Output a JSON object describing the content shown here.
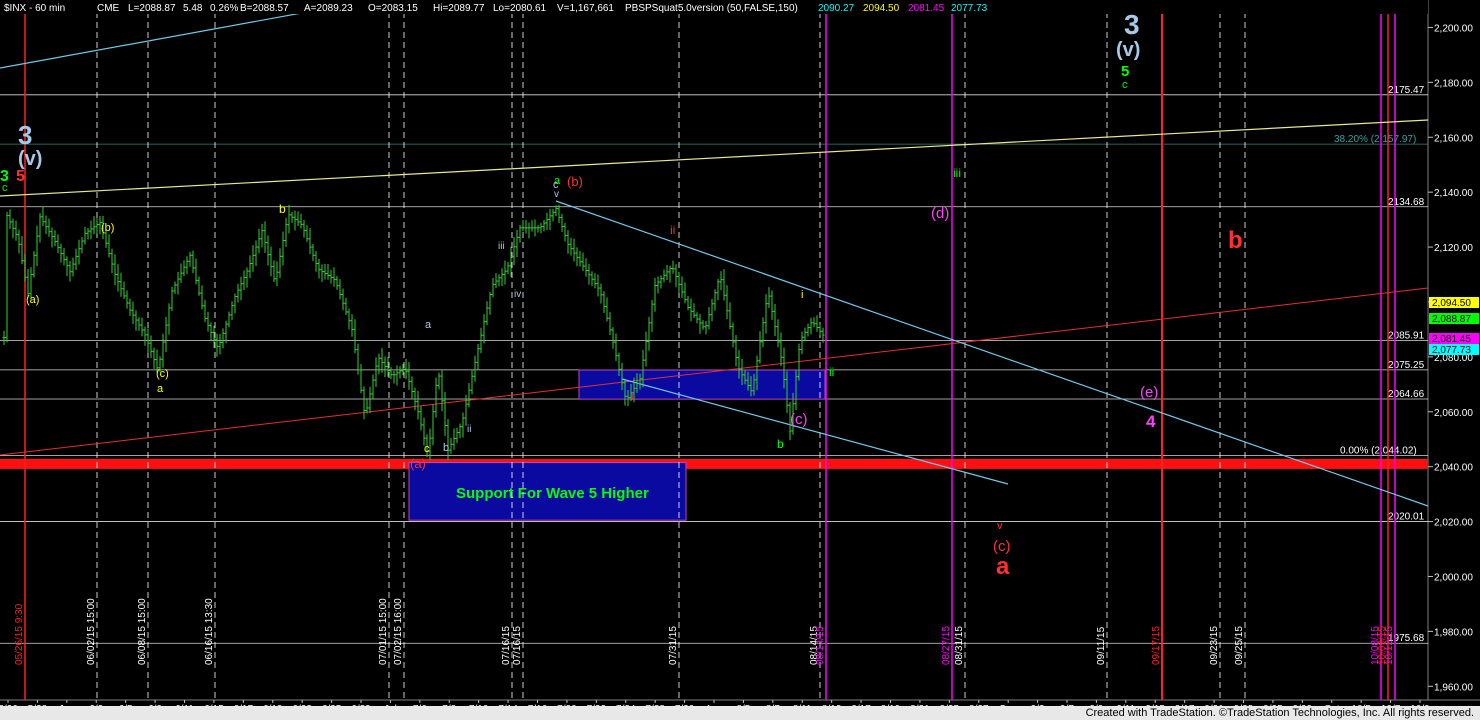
{
  "chart_data": {
    "type": "candlestick",
    "header": {
      "symbol": "$INX - 60 min",
      "exchange": "CME",
      "last": "L=2088.87",
      "change": "5.48",
      "change_pct": "0.26%",
      "bid": "B=2088.57",
      "ask": "A=2089.23",
      "open": "O=2083.15",
      "high": "Hi=2089.77",
      "low": "Lo=2080.61",
      "volume": "V=1,167,661",
      "indicator": "PBSPSquat5.0version (50,FALSE,150)",
      "ind_values": [
        "2090.27",
        "2094.50",
        "2081.45",
        "2077.73"
      ],
      "ind_colors": [
        "#00ffff",
        "#ffff00",
        "#ff00ff",
        "#00ffff"
      ]
    },
    "ylim": [
      1955,
      2210
    ],
    "y_ticks": [
      "1,960.00",
      "1,980.00",
      "2,000.00",
      "2,020.00",
      "2,040.00",
      "2,060.00",
      "2,080.00",
      "2,100.00",
      "2,120.00",
      "2,140.00",
      "2,160.00",
      "2,180.00",
      "2,200.00"
    ],
    "y_tick_values": [
      1960,
      1980,
      2000,
      2020,
      2040,
      2060,
      2080,
      2100,
      2120,
      2140,
      2160,
      2180,
      2200
    ],
    "x_ticks": [
      "5/26",
      "5/28",
      "Jun",
      "6/3",
      "6/5",
      "6/9",
      "6/11",
      "6/15",
      "6/17",
      "6/19",
      "6/23",
      "6/25",
      "6/29",
      "Jul",
      "7/6",
      "7/8",
      "7/10",
      "7/14",
      "7/16",
      "7/20",
      "7/22",
      "7/24",
      "7/28",
      "7/30",
      "Aug",
      "8/5",
      "8/7",
      "8/11",
      "8/13",
      "8/17",
      "8/19",
      "8/21",
      "8/25",
      "8/27",
      "Sep",
      "9/3",
      "9/7",
      "9/9",
      "9/11",
      "9/15",
      "9/17",
      "9/21",
      "9/23",
      "9/25",
      "9/29",
      "Oct",
      "10/5",
      "10/7",
      "10/9"
    ],
    "price_lines": [
      {
        "value": 2175.47,
        "label": "2175.47",
        "color": "#ffffff"
      },
      {
        "value": 2134.68,
        "label": "2134.68",
        "color": "#ffffff"
      },
      {
        "value": 2085.91,
        "label": "2085.91",
        "color": "#ffffff"
      },
      {
        "value": 2075.25,
        "label": "2075.25",
        "color": "#ffffff"
      },
      {
        "value": 2064.66,
        "label": "2064.66",
        "color": "#ffffff"
      },
      {
        "value": 2044.02,
        "label": "0.00% (2,044.02)",
        "color": "#ffffff"
      },
      {
        "value": 2020.01,
        "label": "2020.01",
        "color": "#ffffff"
      },
      {
        "value": 1975.68,
        "label": "1975.68",
        "color": "#ffffff"
      },
      {
        "value": 2157.5,
        "label": "38.20% (2,157.97)",
        "color": "#3aa0a0"
      }
    ],
    "last_price_tags": [
      {
        "value": 2094.5,
        "label": "2,094.50",
        "bg": "#ffff00",
        "fg": "#000000"
      },
      {
        "value": 2088.87,
        "label": "2,088.87",
        "bg": "#00ff00",
        "fg": "#000000"
      },
      {
        "value": 2081.45,
        "label": "2,081.45",
        "bg": "#ff00ff",
        "fg": "#000000"
      },
      {
        "value": 2077.73,
        "label": "2,077.73",
        "bg": "#00ffff",
        "fg": "#000000"
      }
    ],
    "support_band": {
      "value": 2041,
      "label": "Support For Wave 5 Higher"
    },
    "date_markers": [
      {
        "label": "05/26/15 9:30"
      },
      {
        "label": "06/02/15 15:00"
      },
      {
        "label": "06/08/15 15:00"
      },
      {
        "label": "06/16/15 13:30"
      },
      {
        "label": "07/01/15 15:00"
      },
      {
        "label": "07/02/15 16:00"
      },
      {
        "label": "07/16/15"
      },
      {
        "label": "07/16/15"
      },
      {
        "label": "07/31/15"
      },
      {
        "label": "08/14/15"
      },
      {
        "label": "08/14/15"
      },
      {
        "label": "08/27/15"
      },
      {
        "label": "08/31/15"
      },
      {
        "label": "09/11/15"
      },
      {
        "label": "09/17/15"
      },
      {
        "label": "09/23/15"
      },
      {
        "label": "09/25/15"
      },
      {
        "label": "10/08/15"
      },
      {
        "label": "10/09/15"
      },
      {
        "label": "10/12/15"
      }
    ],
    "wave_labels": [
      {
        "text": "3",
        "color": "#a8c8e8"
      },
      {
        "text": "(v)",
        "color": "#a8c8e8"
      },
      {
        "text": "3",
        "color": "#00ff00"
      },
      {
        "text": "5",
        "color": "#ff3030"
      },
      {
        "text": "c",
        "color": "#00ff00"
      },
      {
        "text": "(a)",
        "color": "#ffff00"
      },
      {
        "text": "(b)",
        "color": "#ffff00"
      },
      {
        "text": "(c)",
        "color": "#ffff00"
      },
      {
        "text": "a",
        "color": "#ffff00"
      },
      {
        "text": "b",
        "color": "#ffff00"
      },
      {
        "text": "a",
        "color": "#a8c8e8"
      },
      {
        "text": "c",
        "color": "#ffff00"
      },
      {
        "text": "b",
        "color": "#a8c8e8"
      },
      {
        "text": "ii",
        "color": "#a8c8e8"
      },
      {
        "text": "iii",
        "color": "#a8c8e8"
      },
      {
        "text": "iv",
        "color": "#a8c8e8"
      },
      {
        "text": "a",
        "color": "#00ff00"
      },
      {
        "text": "c",
        "color": "#a8c8e8"
      },
      {
        "text": "v",
        "color": "#a8c8e8"
      },
      {
        "text": "(b)",
        "color": "#ff3030"
      },
      {
        "text": "(a)",
        "color": "#ff3030"
      },
      {
        "text": "ii",
        "color": "#ff3030"
      },
      {
        "text": "i",
        "color": "#ff3030"
      },
      {
        "text": "i",
        "color": "#ffff00"
      },
      {
        "text": "b",
        "color": "#00ff00"
      },
      {
        "text": "(c)",
        "color": "#ff40ff"
      },
      {
        "text": "ii",
        "color": "#00ff00"
      },
      {
        "text": "iii",
        "color": "#00ff00"
      },
      {
        "text": "(d)",
        "color": "#ff40ff"
      },
      {
        "text": "(e)",
        "color": "#ff40ff"
      },
      {
        "text": "4",
        "color": "#ff40ff"
      },
      {
        "text": "v",
        "color": "#ff3030"
      },
      {
        "text": "(c)",
        "color": "#ff3030"
      },
      {
        "text": "a",
        "color": "#ff3030"
      },
      {
        "text": "b",
        "color": "#ff3030"
      },
      {
        "text": "3",
        "color": "#a8c8e8"
      },
      {
        "text": "(v)",
        "color": "#a8c8e8"
      },
      {
        "text": "5",
        "color": "#00ff00"
      },
      {
        "text": "c",
        "color": "#00ff00"
      }
    ],
    "footer": "Created with TradeStation. ©TradeStation Technologies, Inc. All rights reserved."
  }
}
